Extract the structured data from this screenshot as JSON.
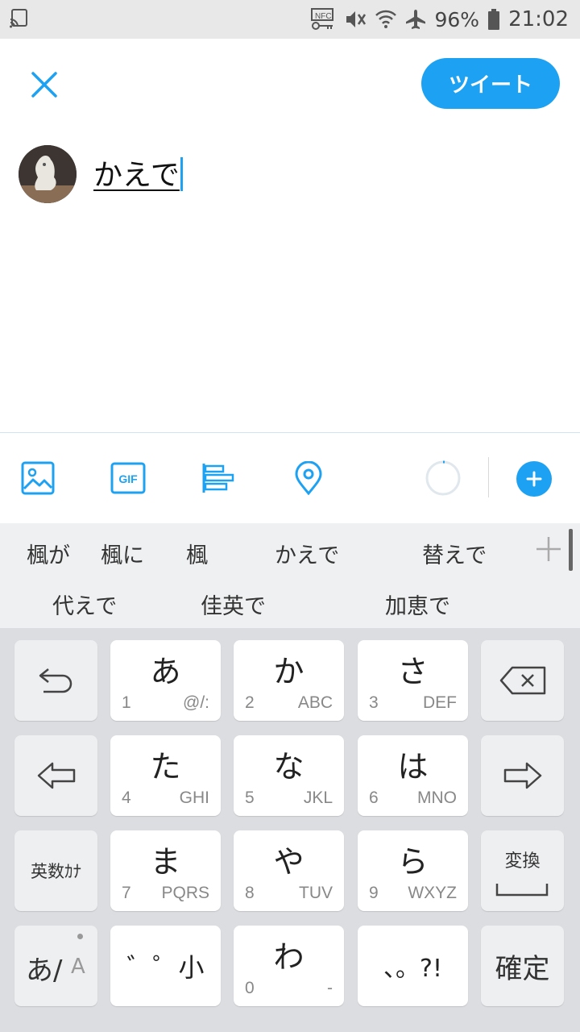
{
  "status_bar": {
    "battery_percent": "96%",
    "time": "21:02"
  },
  "compose": {
    "tweet_button_label": "ツイート",
    "text": "かえで"
  },
  "toolbar": {
    "icons": [
      "image-icon",
      "gif-icon",
      "poll-icon",
      "location-icon"
    ],
    "gif_label": "GIF"
  },
  "candidates": {
    "row1": [
      "楓が",
      "楓に",
      "楓",
      "かえで",
      "替えで"
    ],
    "row2": [
      "代えで",
      "佳英で",
      "加恵で"
    ]
  },
  "keyboard": {
    "keys": {
      "a": {
        "main": "あ",
        "num": "1",
        "sub": "@/:"
      },
      "ka": {
        "main": "か",
        "num": "2",
        "sub": "ABC"
      },
      "sa": {
        "main": "さ",
        "num": "3",
        "sub": "DEF"
      },
      "ta": {
        "main": "た",
        "num": "4",
        "sub": "GHI"
      },
      "na": {
        "main": "な",
        "num": "5",
        "sub": "JKL"
      },
      "ha": {
        "main": "は",
        "num": "6",
        "sub": "MNO"
      },
      "ma": {
        "main": "ま",
        "num": "7",
        "sub": "PQRS"
      },
      "ya": {
        "main": "や",
        "num": "8",
        "sub": "TUV"
      },
      "ra": {
        "main": "ら",
        "num": "9",
        "sub": "WXYZ"
      },
      "wa": {
        "main": "わ",
        "num": "0",
        "sub": "-"
      },
      "dakuten": "゛゜小",
      "punct": "、。?!"
    },
    "eisu_label": "英数ｶﾅ",
    "henkan_label": "変換",
    "kakutei_label": "確定",
    "mode_label_main": "あ/",
    "mode_label_sub": "A"
  }
}
